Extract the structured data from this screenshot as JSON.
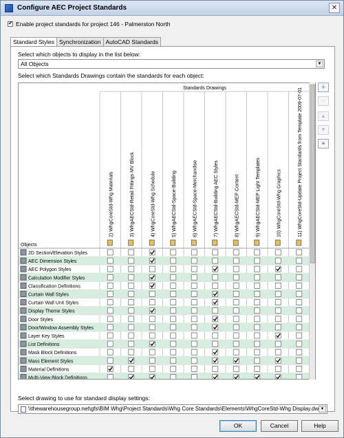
{
  "window": {
    "title": "Configure AEC Project Standards",
    "enable_label": "Enable project standards for project 146 - Palmerston North",
    "enable_checked": true
  },
  "tabs": [
    {
      "label": "Standard Styles",
      "active": true
    },
    {
      "label": "Synchronization",
      "active": false
    },
    {
      "label": "AutoCAD Standards",
      "active": false
    }
  ],
  "panel": {
    "select_objects_label": "Select which objects to display in the list below:",
    "objects_filter_value": "All Objects",
    "select_drawings_label": "Select which Standards Drawings contain the standards for each object:",
    "display_settings_label": "Select drawing to use for standard display settings:",
    "display_drawing_path": "\\\\thewarehousegroup.net\\gfs\\BIM Whg\\Project Standards\\Whg Core Standards\\Elements\\WhgCoreStd-Whg Display.dwg"
  },
  "grid": {
    "group_header": "Standards Drawings",
    "objects_header": "Objects",
    "columns": [
      "2) WhgCoreStd-Whg Materials",
      "3) WhgAECStd-Retail Fittings MV Block",
      "4) WhgCoreStd-Whg Schedule",
      "5) WhgAECStd-Space-Building",
      "6) WhgAECStd-Space-Merchandise",
      "7) WhgAECStd-Building AEC Styles",
      "8) WhgAECStd-MEP Content",
      "9) WhgAECStd-MEP Light Templates",
      "10) WhgCoreStd-Whg Graphics",
      "11) WhgCoreStd-Update Project Standards from Template 2009-07-01"
    ],
    "rows": [
      {
        "name": "2D Section/Elevation Styles",
        "checks": [
          0,
          0,
          1,
          0,
          0,
          0,
          0,
          0,
          0,
          0
        ]
      },
      {
        "name": "AEC Dimension Styles",
        "checks": [
          0,
          0,
          1,
          0,
          0,
          0,
          0,
          0,
          0,
          0
        ]
      },
      {
        "name": "AEC Polygon Styles",
        "checks": [
          0,
          0,
          0,
          0,
          0,
          1,
          0,
          0,
          1,
          0
        ]
      },
      {
        "name": "Calculation Modifier Styles",
        "checks": [
          0,
          0,
          1,
          0,
          0,
          0,
          0,
          0,
          0,
          0
        ]
      },
      {
        "name": "Classification Definitions",
        "checks": [
          0,
          0,
          1,
          0,
          0,
          0,
          0,
          0,
          0,
          0
        ]
      },
      {
        "name": "Curtain Wall Styles",
        "checks": [
          0,
          0,
          0,
          0,
          0,
          1,
          0,
          0,
          0,
          0
        ]
      },
      {
        "name": "Curtain Wall Unit Styles",
        "checks": [
          0,
          0,
          0,
          0,
          0,
          1,
          0,
          0,
          0,
          0
        ]
      },
      {
        "name": "Display Theme Styles",
        "checks": [
          0,
          0,
          1,
          0,
          0,
          0,
          0,
          0,
          0,
          0
        ]
      },
      {
        "name": "Door Styles",
        "checks": [
          0,
          0,
          0,
          0,
          0,
          1,
          0,
          0,
          0,
          0
        ]
      },
      {
        "name": "Door/Window Assembly Styles",
        "checks": [
          0,
          0,
          0,
          0,
          0,
          1,
          0,
          0,
          0,
          0
        ]
      },
      {
        "name": "Layer Key Styles",
        "checks": [
          0,
          0,
          0,
          0,
          0,
          0,
          0,
          0,
          1,
          0
        ]
      },
      {
        "name": "List Definitions",
        "checks": [
          0,
          0,
          1,
          0,
          0,
          0,
          0,
          0,
          0,
          0
        ]
      },
      {
        "name": "Mask Block Definitions",
        "checks": [
          0,
          0,
          0,
          0,
          0,
          1,
          0,
          0,
          0,
          0
        ]
      },
      {
        "name": "Mass Element Styles",
        "checks": [
          0,
          1,
          0,
          0,
          0,
          1,
          1,
          0,
          1,
          0
        ]
      },
      {
        "name": "Material Definitions",
        "checks": [
          1,
          0,
          0,
          0,
          0,
          0,
          0,
          0,
          0,
          0
        ]
      },
      {
        "name": "Multi-View Block Definitions",
        "checks": [
          0,
          1,
          1,
          0,
          0,
          1,
          1,
          1,
          1,
          0
        ]
      }
    ],
    "checkbox_accent": "#d4ecdf",
    "row_alt_color": "#d7eddf"
  },
  "side_buttons": [
    {
      "icon": "add-drawing-icon",
      "glyph": "+",
      "enabled": true
    },
    {
      "icon": "remove-drawing-icon",
      "glyph": "−",
      "enabled": false
    },
    {
      "icon": "move-up-icon",
      "glyph": "▲",
      "enabled": false
    },
    {
      "icon": "move-down-icon",
      "glyph": "▼",
      "enabled": false
    },
    {
      "icon": "sync-icon",
      "glyph": "≡",
      "enabled": true
    }
  ],
  "buttons": {
    "ok": "OK",
    "cancel": "Cancel",
    "help": "Help"
  }
}
